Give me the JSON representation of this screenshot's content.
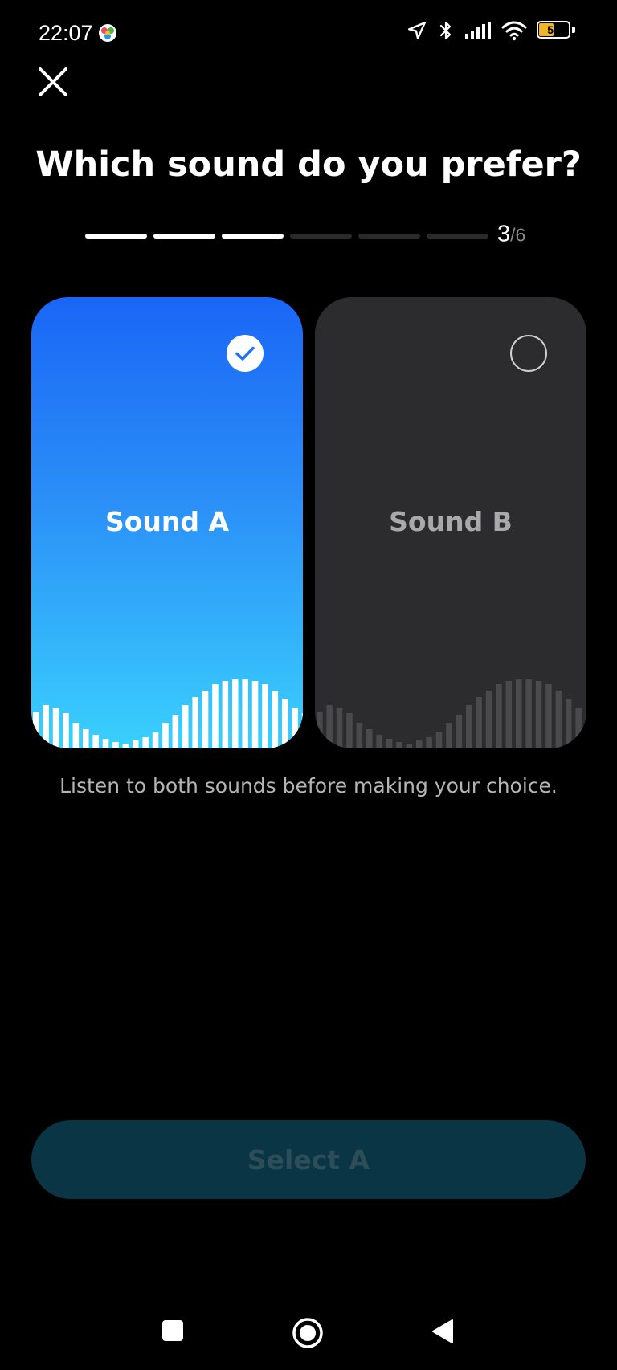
{
  "status_bar": {
    "time": "22:07",
    "battery_level": "50"
  },
  "header": {
    "title": "Which sound do you prefer?"
  },
  "progress": {
    "current": "3",
    "separator": "/",
    "total": "6",
    "completed_steps": 3
  },
  "cards": [
    {
      "label": "Sound A",
      "selected": true
    },
    {
      "label": "Sound B",
      "selected": false
    }
  ],
  "hint": "Listen to both sounds before making your choice.",
  "primary_action": {
    "label": "Select A"
  },
  "colors": {
    "background": "#000000",
    "card_selected_top": "#1a66f6",
    "card_selected_bottom": "#3ad0fd",
    "card_unselected": "#2c2c2e",
    "button_bg": "#0a3544",
    "button_text": "#2d4d59"
  },
  "icons": {
    "close": "close-icon",
    "check": "check-icon",
    "radio": "radio-unchecked-icon",
    "nav_recents": "square-icon",
    "nav_home": "circle-icon",
    "nav_back": "triangle-back-icon"
  }
}
